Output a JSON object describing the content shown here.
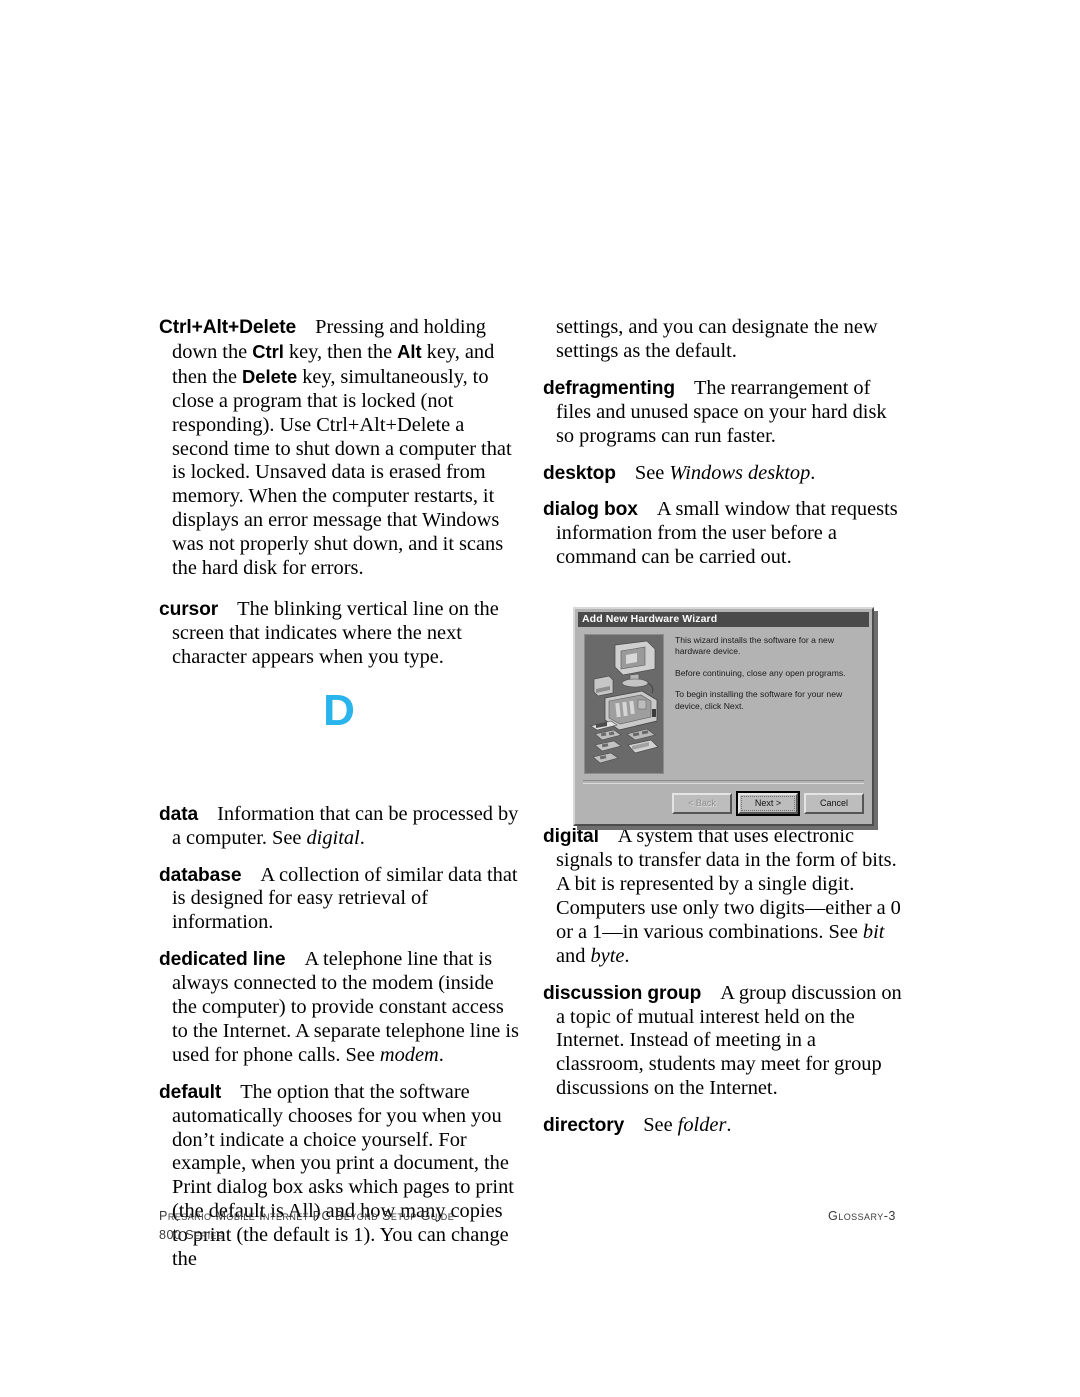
{
  "page": {
    "section_letter": "D",
    "section_letter_color": "#29b4ec",
    "background_color": "#ffffff"
  },
  "left_column": {
    "entries": [
      {
        "term": "Ctrl+Alt+Delete",
        "definition_parts": [
          {
            "text": "Pressing and holding down the ",
            "style": "normal"
          },
          {
            "text": "Ctrl",
            "style": "bold"
          },
          {
            "text": " key, then the ",
            "style": "normal"
          },
          {
            "text": "Alt",
            "style": "bold"
          },
          {
            "text": " key, and then the ",
            "style": "normal"
          },
          {
            "text": "Delete",
            "style": "bold"
          },
          {
            "text": " key, simultaneously, to close a program that is locked (not responding). Use Ctrl+Alt+Delete a second time to shut down a computer that is locked. Unsaved data is erased from memory. When the computer restarts, it displays an error message that Windows was not properly shut down, and it scans the hard disk for errors.",
            "style": "normal"
          }
        ]
      },
      {
        "term": "cursor",
        "definition_parts": [
          {
            "text": "The blinking vertical line on the screen that indicates where the next character appears when you type.",
            "style": "normal"
          }
        ]
      },
      {
        "term": "data",
        "definition_parts": [
          {
            "text": "Information that can be processed by a computer. See ",
            "style": "normal"
          },
          {
            "text": "digital",
            "style": "italic"
          },
          {
            "text": ".",
            "style": "normal"
          }
        ]
      },
      {
        "term": "database",
        "definition_parts": [
          {
            "text": "A collection of similar data that is designed for easy retrieval of information.",
            "style": "normal"
          }
        ]
      },
      {
        "term": "dedicated line",
        "definition_parts": [
          {
            "text": "A telephone line that is always connected to the modem (inside the computer) to provide constant access to the Internet. A separate telephone line is used for phone calls. See ",
            "style": "normal"
          },
          {
            "text": "modem",
            "style": "italic"
          },
          {
            "text": ".",
            "style": "normal"
          }
        ]
      },
      {
        "term": "default",
        "definition_parts": [
          {
            "text": "The option that the software automatically chooses for you when you don’t indicate a choice yourself. For example, when you print a document, the Print dialog box asks which pages to print (the default is All) and how many copies to print (the default is 1). You can change the",
            "style": "normal"
          }
        ]
      }
    ]
  },
  "right_column": {
    "continuation_text": "settings, and you can designate the new settings as the default.",
    "entries": [
      {
        "term": "defragmenting",
        "definition_parts": [
          {
            "text": "The rearrangement of files and unused space on your hard disk so programs can run faster.",
            "style": "normal"
          }
        ]
      },
      {
        "term": "desktop",
        "definition_parts": [
          {
            "text": "See ",
            "style": "normal"
          },
          {
            "text": "Windows desktop",
            "style": "italic"
          },
          {
            "text": ".",
            "style": "normal"
          }
        ]
      },
      {
        "term": "dialog box",
        "definition_parts": [
          {
            "text": "A small window that requests information from the user before a command can be carried out.",
            "style": "normal"
          }
        ]
      }
    ],
    "entries_after_figure": [
      {
        "term": "digital",
        "definition_parts": [
          {
            "text": "A system that uses electronic signals to transfer data in the form of bits. A bit is represented by a single digit. Computers use only two digits—either a 0 or a 1—in various combinations. See ",
            "style": "normal"
          },
          {
            "text": "bit",
            "style": "italic"
          },
          {
            "text": " and ",
            "style": "normal"
          },
          {
            "text": "byte",
            "style": "italic"
          },
          {
            "text": ".",
            "style": "normal"
          }
        ]
      },
      {
        "term": "discussion group",
        "definition_parts": [
          {
            "text": "A group discussion on a topic of mutual interest held on the Internet. Instead of meeting in a classroom, students may meet for group discussions on the Internet.",
            "style": "normal"
          }
        ]
      },
      {
        "term": "directory",
        "definition_parts": [
          {
            "text": "See ",
            "style": "normal"
          },
          {
            "text": "folder",
            "style": "italic"
          },
          {
            "text": ".",
            "style": "normal"
          }
        ]
      }
    ]
  },
  "figure": {
    "window_title": "Add New Hardware Wizard",
    "paragraphs": [
      "This wizard installs the software for a new hardware device.",
      "Before continuing, close any open programs.",
      "To begin installing the software for your new device, click Next."
    ],
    "illustration_name": "computer-hardware-illustration",
    "buttons": [
      {
        "label": "< Back",
        "state": "disabled"
      },
      {
        "label": "Next >",
        "state": "default"
      },
      {
        "label": "Cancel",
        "state": "normal"
      }
    ],
    "titlebar_color": "#4a4a4a",
    "face_color": "#b3b3b3"
  },
  "footer": {
    "line1": "Presario Mobile Internet PC Beyond Setup Guide",
    "line2": "800 Series",
    "page_label": "Glossary-3"
  }
}
